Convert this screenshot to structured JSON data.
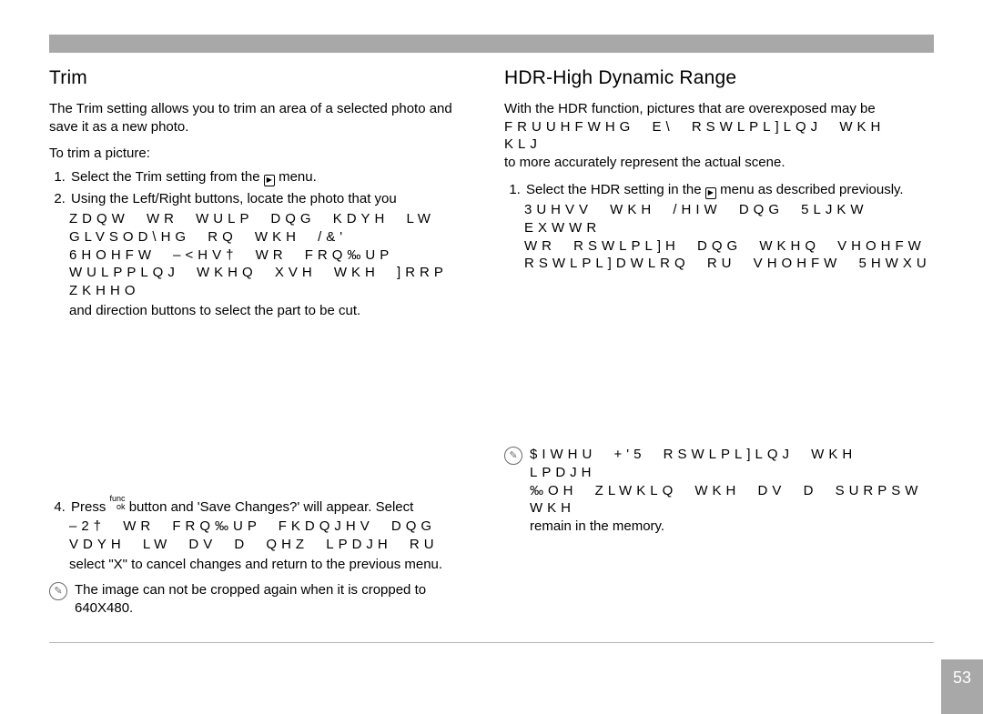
{
  "page_number": "53",
  "left": {
    "heading": "Trim",
    "intro": "The Trim setting allows you to trim an area of a selected photo and save it as a new photo.",
    "howto_label": "To trim a picture:",
    "step1_a": "Select the Trim setting from the ",
    "step1_b": " menu.",
    "step2": "Using the Left/Right buttons, locate the photo that you",
    "garbled1": "ZDQW WR WULP DQG KDYH LW GLVSOD\\HG RQ WKH /&'",
    "garbled2": "6HOHFW ‒<HV† WR FRQ‰UP WULPPLQJ WKHQ XVH WKH ]RRP ZKHHO",
    "step3b": "and direction buttons to select the part to be cut.",
    "step4_a": "Press ",
    "step4_b": " button and 'Save Changes?' will appear. Select",
    "garbled3": "‒2† WR FRQ‰UP FKDQJHV DQG VDYH LW DV D QHZ LPDJH RU",
    "step4c": "select \"X\" to cancel changes and return to the previous menu.",
    "note": "The image can not be cropped again when it is cropped to 640X480."
  },
  "right": {
    "heading": "HDR-High Dynamic Range",
    "intro1": "With the HDR function, pictures that are overexposed may be",
    "garbled_intro": "FRUUHFWHG E\\ RSWLPL]LQJ WKH KLJ",
    "intro2": "to more accurately represent the actual scene.",
    "step1_a": "Select the HDR setting in the ",
    "step1_b": " menu as described previously.",
    "garbled_r1": "3UHVV WKH /HIW DQG 5LJKW EXWWR",
    "garbled_r2": "WR RSWLPL]H DQG WKHQ VHOHFW",
    "garbled_r3": "RSWLPL]DWLRQ RU VHOHFW 5HWXU",
    "garbled_note1": "$IWHU +'5 RSWLPL]LQJ WKH LPDJH",
    "garbled_note2": "‰OH ZLWKLQ WKH DV D SURPSW WKH",
    "note_tail": "remain in the memory."
  }
}
